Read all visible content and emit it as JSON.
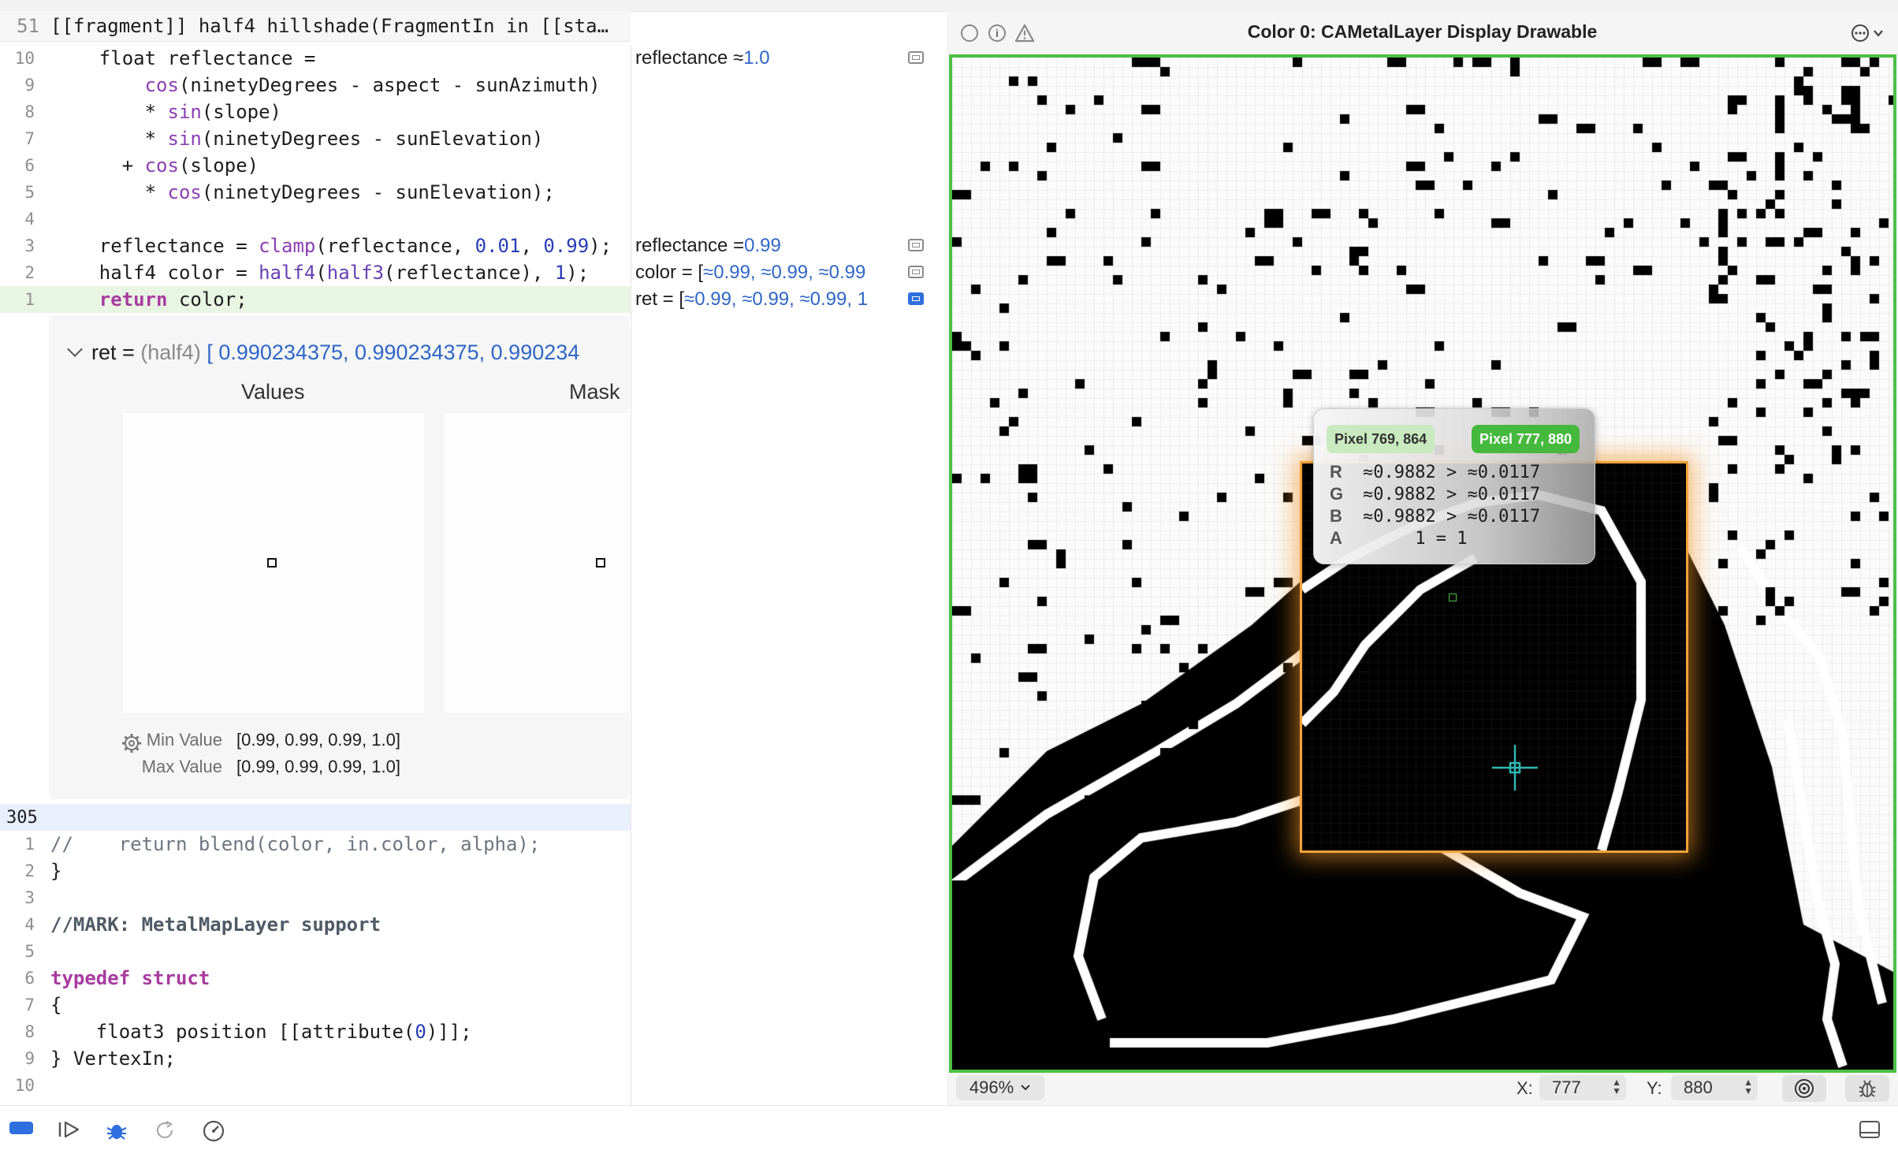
{
  "editor": {
    "header": {
      "line_no": "51",
      "text": "[[fragment]] half4 hillshade(FragmentIn in [[sta…"
    },
    "code_lines": [
      {
        "ln": "10",
        "text": "    float reflectance =",
        "result": "reflectance ≈ ",
        "result_val": "1.0",
        "icon": true
      },
      {
        "ln": "9",
        "text": "        cos(ninetyDegrees - aspect - sunAzimuth)"
      },
      {
        "ln": "8",
        "text": "        * sin(slope)"
      },
      {
        "ln": "7",
        "text": "        * sin(ninetyDegrees - sunElevation)"
      },
      {
        "ln": "6",
        "text": "      + cos(slope)"
      },
      {
        "ln": "5",
        "text": "        * cos(ninetyDegrees - sunElevation);"
      },
      {
        "ln": "4",
        "text": ""
      },
      {
        "ln": "3",
        "text": "    reflectance = clamp(reflectance, 0.01, 0.99);",
        "result": "reflectance = ",
        "result_val": "0.99",
        "icon": true
      },
      {
        "ln": "2",
        "text": "    half4 color = half4(half3(reflectance), 1);",
        "result": "color = [ ",
        "result_val": "≈0.99, ≈0.99, ≈0.99",
        "icon": true
      },
      {
        "ln": "1",
        "text": "    return color;",
        "result": "ret = [ ",
        "result_val": "≈0.99, ≈0.99, ≈0.99, 1",
        "icon": true,
        "selected": true
      }
    ],
    "inspector": {
      "title_prefix": "ret = ",
      "title_type": "(half4)",
      "title_values": "[ 0.990234375, 0.990234375, 0.990234",
      "values_label": "Values",
      "mask_label": "Mask",
      "min_label": "Min Value",
      "min_value": "[0.99, 0.99, 0.99, 1.0]",
      "max_label": "Max Value",
      "max_value": "[0.99, 0.99, 0.99, 1.0]"
    },
    "section_number": "305",
    "code_lines_b": [
      {
        "ln": "1",
        "text": "//    return blend(color, in.color, alpha);"
      },
      {
        "ln": "2",
        "text": "}"
      },
      {
        "ln": "3",
        "text": ""
      },
      {
        "ln": "4",
        "text": "//MARK: MetalMapLayer support"
      },
      {
        "ln": "5",
        "text": ""
      },
      {
        "ln": "6",
        "text": "typedef struct"
      },
      {
        "ln": "7",
        "text": "{"
      },
      {
        "ln": "8",
        "text": "    float3 position [[attribute(0)]];"
      },
      {
        "ln": "9",
        "text": "} VertexIn;"
      },
      {
        "ln": "10",
        "text": ""
      }
    ]
  },
  "viewer": {
    "title": "Color 0: CAMetalLayer Display Drawable",
    "tooltip": {
      "badge_a": "Pixel 769, 864",
      "badge_b": "Pixel 777, 880",
      "rows": [
        {
          "k": "R",
          "v": "≈0.9882 > ≈0.0117"
        },
        {
          "k": "G",
          "v": "≈0.9882 > ≈0.0117"
        },
        {
          "k": "B",
          "v": "≈0.9882 > ≈0.0117"
        },
        {
          "k": "A",
          "v": "     1 = 1"
        }
      ]
    },
    "zoom": "496%",
    "x_label": "X:",
    "x_value": "777",
    "y_label": "Y:",
    "y_value": "880"
  },
  "colors": {
    "accent_green": "#4cc046",
    "highlight_orange": "#f2a33a",
    "link_blue": "#2f66c6",
    "current_line": "#e8f5e2"
  }
}
